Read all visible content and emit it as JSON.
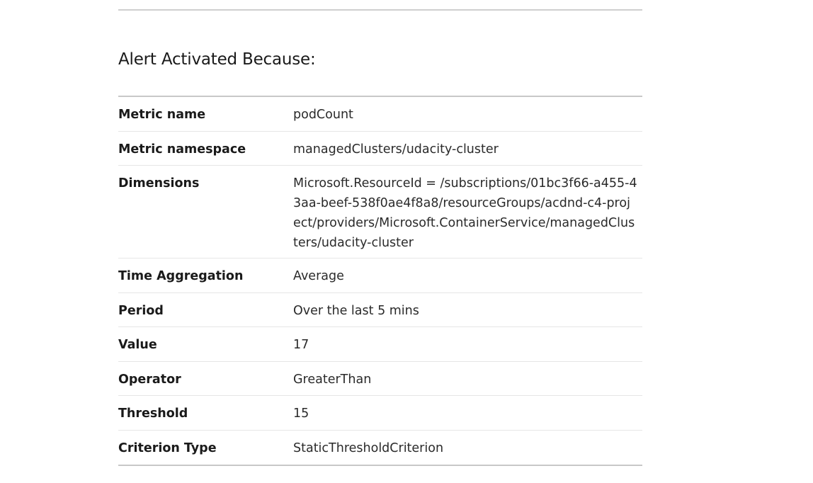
{
  "section": {
    "title": "Alert Activated Because:"
  },
  "rows": [
    {
      "label": "Metric name",
      "value": "podCount"
    },
    {
      "label": "Metric namespace",
      "value": "managedClusters/udacity-cluster"
    },
    {
      "label": "Dimensions",
      "value_lines": [
        "Microsoft.ResourceId = /subscriptions/01bc3f66-a455-4",
        "3aa-beef-538f0ae4f8a8/resourceGroups/acdnd-c4-proj",
        "ect/providers/Microsoft.ContainerService/managedClus",
        "ters/udacity-cluster"
      ]
    },
    {
      "label": "Time Aggregation",
      "value": "Average"
    },
    {
      "label": "Period",
      "value": "Over the last 5 mins"
    },
    {
      "label": "Value",
      "value": "17"
    },
    {
      "label": "Operator",
      "value": "GreaterThan"
    },
    {
      "label": "Threshold",
      "value": "15"
    },
    {
      "label": "Criterion Type",
      "value": "StaticThresholdCriterion"
    }
  ]
}
